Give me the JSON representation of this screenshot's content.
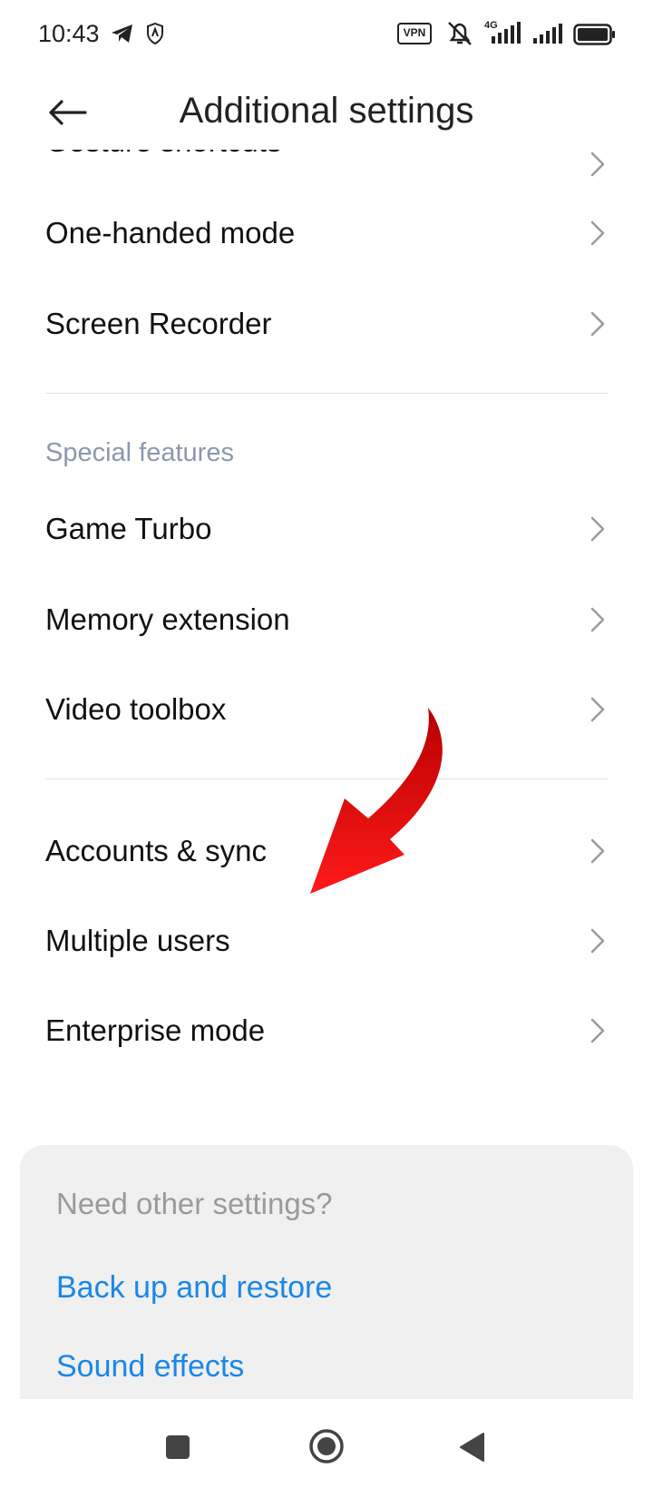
{
  "status_bar": {
    "time": "10:43",
    "vpn_label": "VPN",
    "network_label": "4G",
    "icons": [
      "telegram-icon",
      "shield-icon",
      "vpn-icon",
      "bell-muted-icon",
      "signal-4g-icon",
      "signal-icon",
      "battery-icon"
    ]
  },
  "app_bar": {
    "title": "Additional settings",
    "back_icon": "arrow-left-icon"
  },
  "list": {
    "partial_item": "Gesture shortcuts",
    "group1": [
      "One-handed mode",
      "Screen Recorder"
    ],
    "special_header": "Special features",
    "group2": [
      "Game Turbo",
      "Memory extension",
      "Video toolbox"
    ],
    "group3": [
      "Accounts & sync",
      "Multiple users",
      "Enterprise mode"
    ]
  },
  "card": {
    "title": "Need other settings?",
    "links": [
      "Back up and restore",
      "Sound effects"
    ]
  },
  "colors": {
    "accent_link": "#1a87e8",
    "section_header": "#8c97b0",
    "annotation_arrow": "#e00000",
    "card_bg": "#f0f0f0"
  }
}
